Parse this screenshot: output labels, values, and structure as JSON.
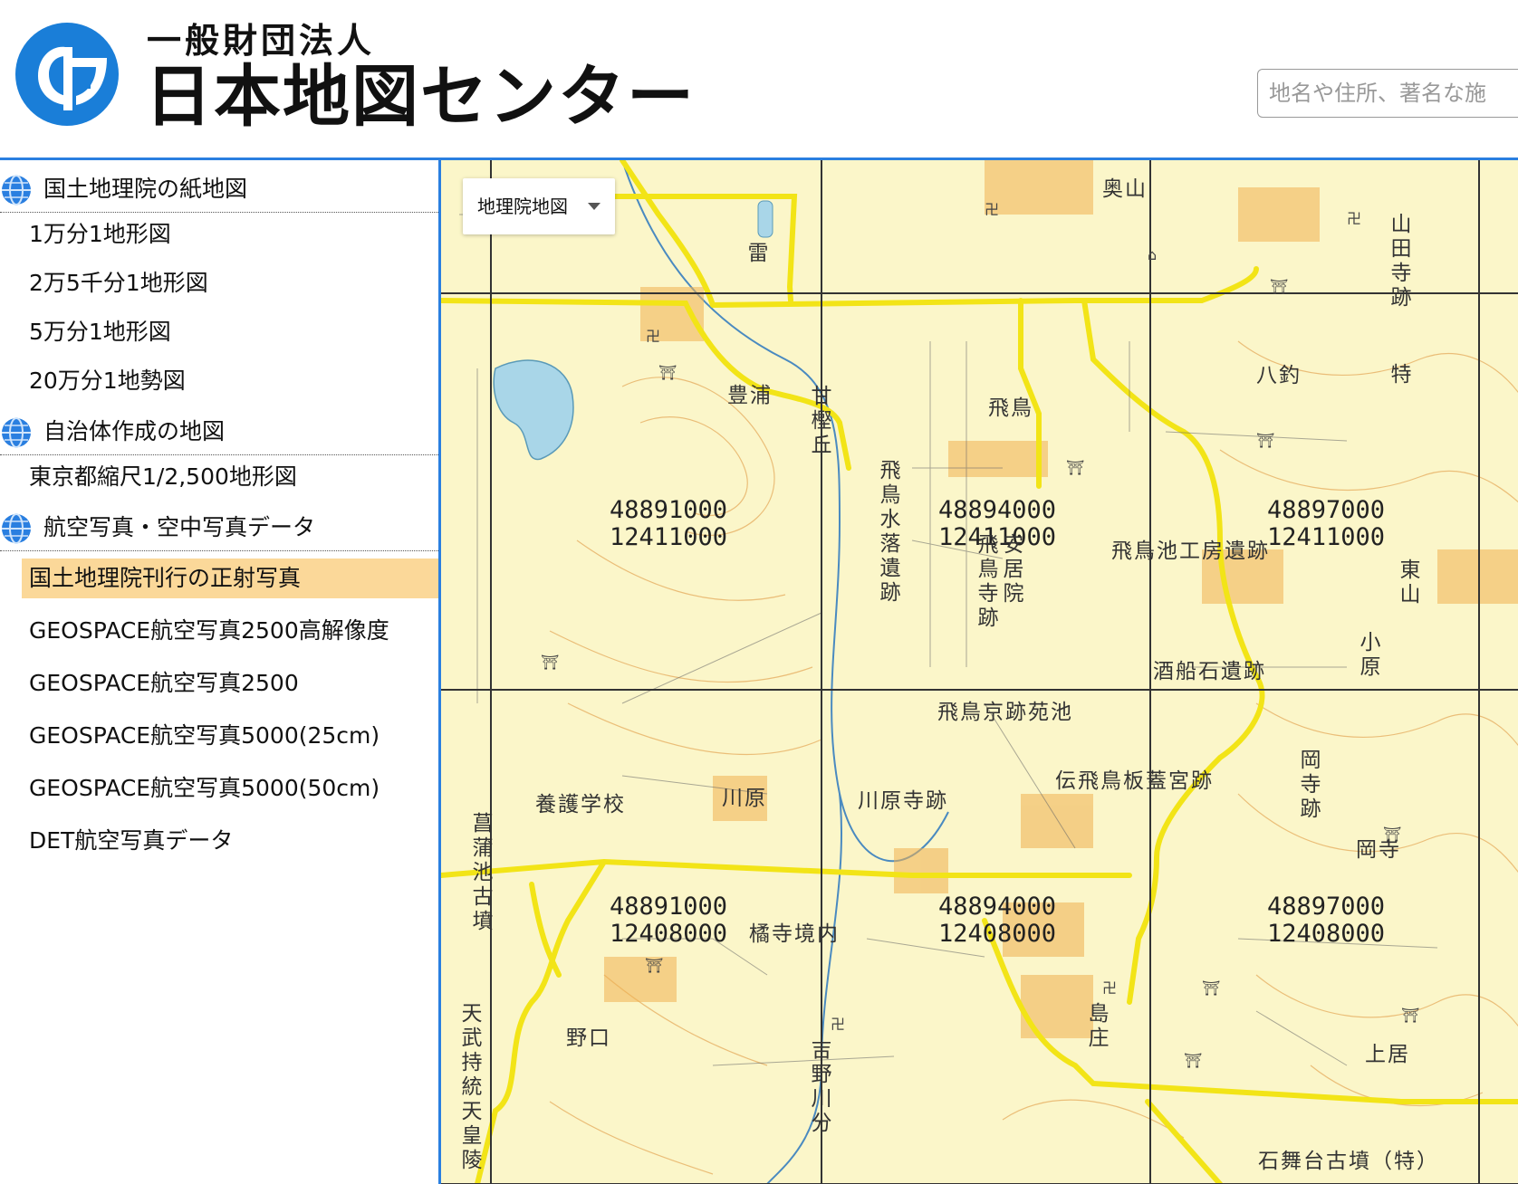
{
  "header": {
    "org_type": "一般財団法人",
    "org_name": "日本地図センター",
    "logo_icon": "jmc-logo-icon",
    "search_placeholder": "地名や住所、著名な施"
  },
  "sidebar": {
    "sections": [
      {
        "label": "国土地理院の紙地図",
        "icon": "globe-icon",
        "items": [
          "1万分1地形図",
          "2万5千分1地形図",
          "5万分1地形図",
          "20万分1地勢図"
        ]
      },
      {
        "label": "自治体作成の地図",
        "icon": "globe-icon",
        "items": [
          "東京都縮尺1/2,500地形図"
        ]
      },
      {
        "label": "航空写真・空中写真データ",
        "icon": "globe-icon",
        "items": [
          "国土地理院刊行の正射写真",
          "GEOSPACE航空写真2500高解像度",
          "GEOSPACE航空写真2500",
          "GEOSPACE航空写真5000(25cm)",
          "GEOSPACE航空写真5000(50cm)",
          "DET航空写真データ"
        ]
      }
    ],
    "active_item": "国土地理院刊行の正射写真",
    "active_color": "#fbd899"
  },
  "map": {
    "layer_select": "地理院地図",
    "tiles": [
      {
        "line1": "48891000",
        "line2": "12411000"
      },
      {
        "line1": "48894000",
        "line2": "12411000"
      },
      {
        "line1": "48897000",
        "line2": "12411000"
      },
      {
        "line1": "48891000",
        "line2": "12408000"
      },
      {
        "line1": "48894000",
        "line2": "12408000"
      },
      {
        "line1": "48897000",
        "line2": "12408000"
      }
    ],
    "places": [
      "奥山",
      "山田寺跡",
      "八釣",
      "豊浦",
      "甘樫丘",
      "飛鳥",
      "飛鳥水落遺跡",
      "飛鳥寺跡",
      "安居院",
      "飛鳥池工房遺跡",
      "東山",
      "小原",
      "酒船石遺跡",
      "飛鳥京跡苑池",
      "伝飛鳥板蓋宮跡",
      "岡寺跡",
      "岡寺",
      "養護学校",
      "川原",
      "川原寺跡",
      "菖蒲池古墳",
      "橘寺境内",
      "島庄",
      "野口",
      "上居",
      "石舞台古墳（特）",
      "吉野川分",
      "天武持統天皇陵",
      "雷",
      "特"
    ],
    "colors": {
      "base": "#fbf6c9",
      "road": "#f2e417",
      "grid": "#333333",
      "contour": "#e8b46a",
      "water": "#a9d6e8",
      "town": "#f0b050"
    }
  }
}
